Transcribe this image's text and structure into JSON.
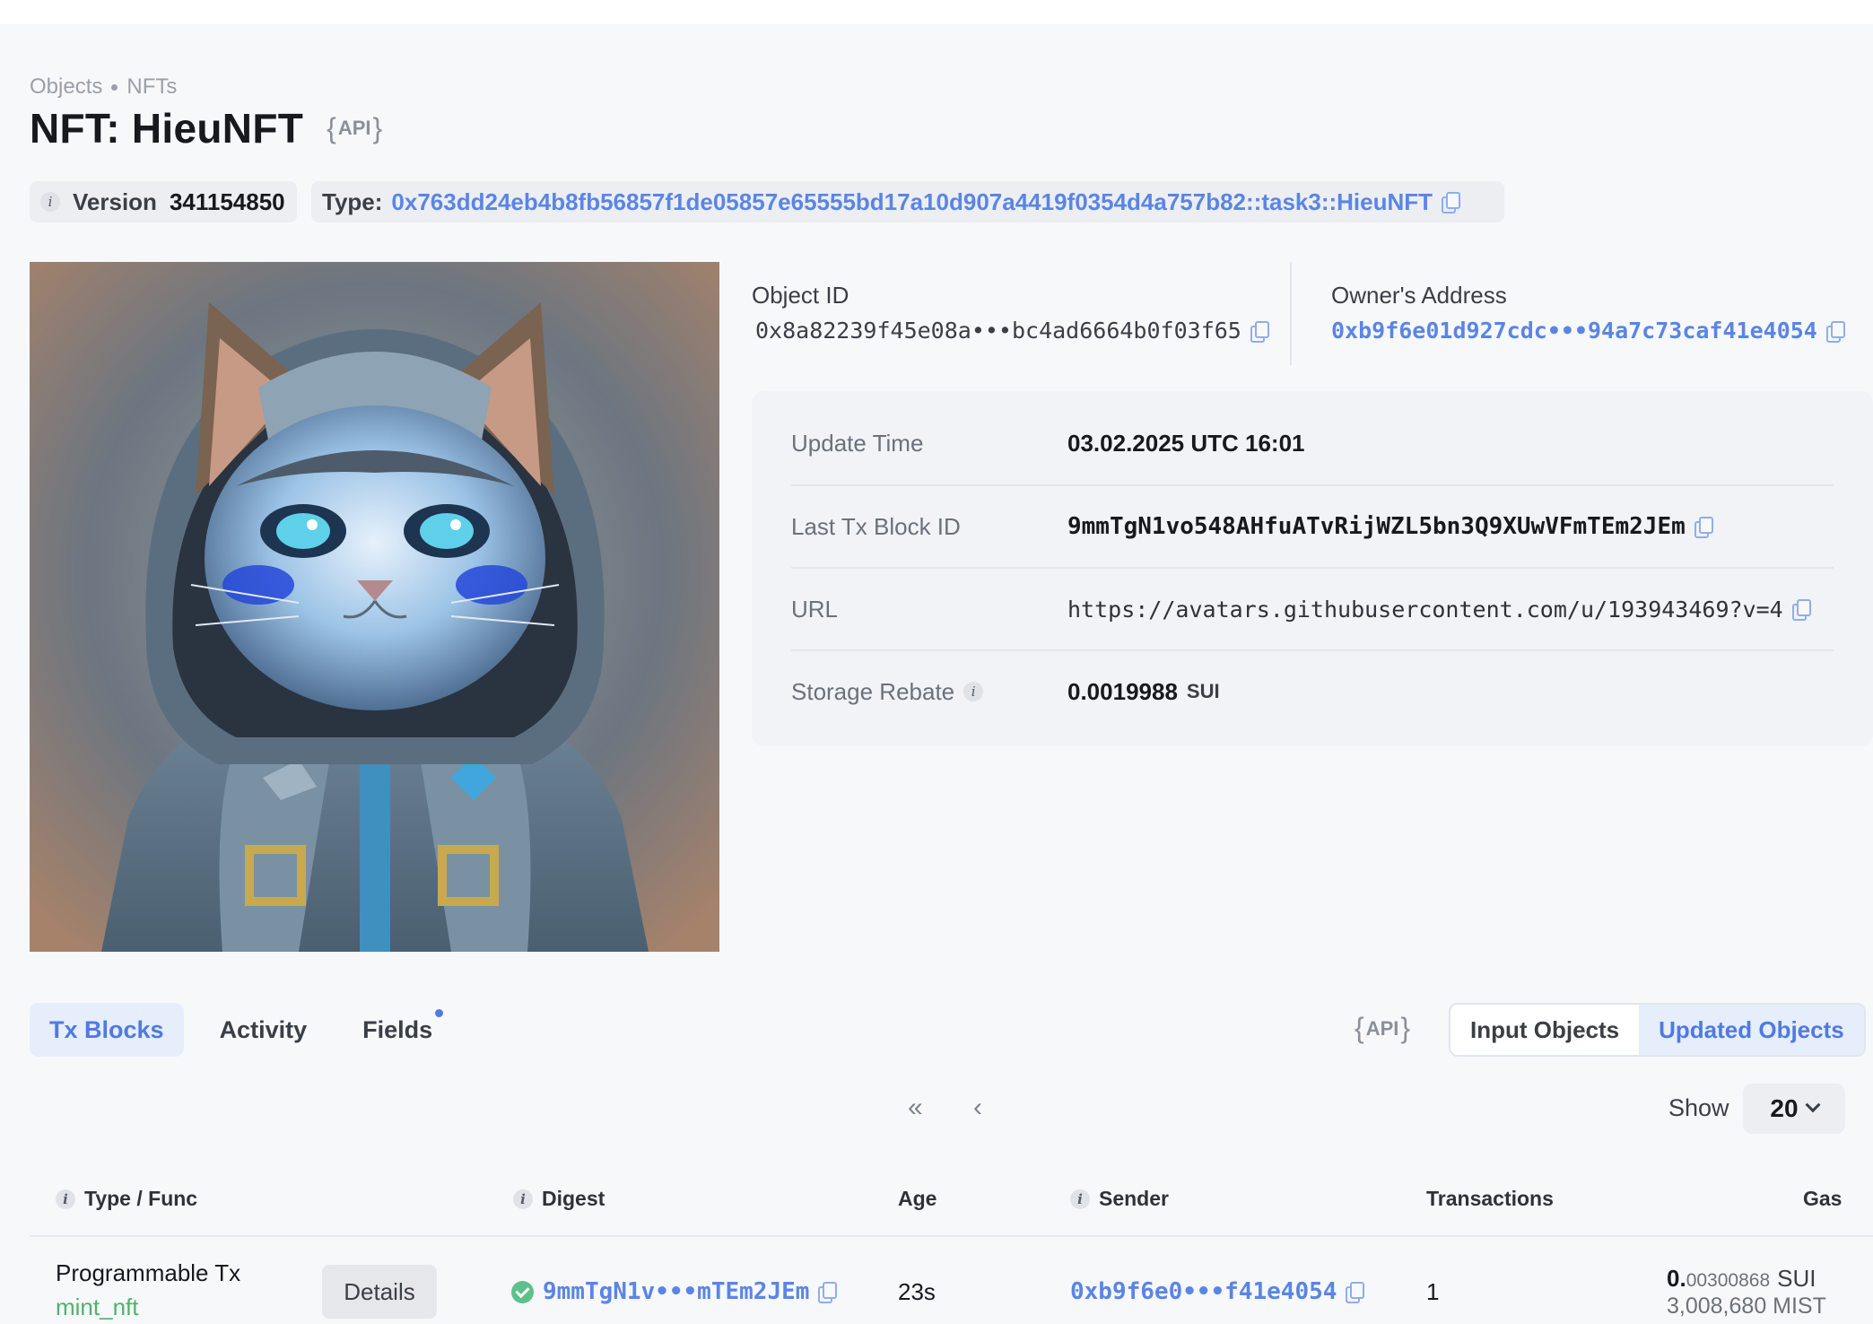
{
  "breadcrumb": [
    "Objects",
    "NFTs"
  ],
  "title": "NFT: HieuNFT",
  "api_badge": "API",
  "version": {
    "label": "Version",
    "value": "341154850"
  },
  "type": {
    "label": "Type:",
    "value": "0x763dd24eb4b8fb56857f1de05857e65555bd17a10d907a4419f0354d4a757b82::task3::HieuNFT"
  },
  "object": {
    "label": "Object ID",
    "value": "0x8a82239f45e08a•••bc4ad6664b0f03f65"
  },
  "owner": {
    "label": "Owner's Address",
    "value": "0xb9f6e01d927cdc•••94a7c73caf41e4054"
  },
  "details": {
    "update_time": {
      "label": "Update Time",
      "value": "03.02.2025 UTC 16:01"
    },
    "last_tx": {
      "label": "Last Tx Block ID",
      "value": "9mmTgN1vo548AHfuATvRijWZL5bn3Q9XUwVFmTEm2JEm"
    },
    "url": {
      "label": "URL",
      "value": "https://avatars.githubusercontent.com/u/193943469?v=4"
    },
    "storage_rebate": {
      "label": "Storage Rebate",
      "value": "0.0019988",
      "unit": "SUI"
    }
  },
  "tabs": [
    "Tx Blocks",
    "Activity",
    "Fields"
  ],
  "segment": [
    "Input Objects",
    "Updated Objects"
  ],
  "pagination": {
    "first": "«",
    "prev": "‹"
  },
  "show": {
    "label": "Show",
    "value": "20"
  },
  "table": {
    "headers": [
      "Type / Func",
      "Digest",
      "Age",
      "Sender",
      "Transactions",
      "Gas"
    ],
    "row": {
      "type": "Programmable Tx",
      "func": "mint_nft",
      "details": "Details",
      "digest": "9mmTgN1v•••mTEm2JEm",
      "age": "23s",
      "sender": "0xb9f6e0•••f41e4054",
      "transactions": "1",
      "gas_int": "0.",
      "gas_frac": "00300868",
      "gas_unit": "SUI",
      "gas_mist": "3,008,680 MIST"
    }
  },
  "colors": {
    "accent": "#5a85e6",
    "success": "#5ec08a",
    "func": "#4db36a"
  },
  "icons": [
    "info-icon",
    "copy-icon",
    "check-circle-icon",
    "chevron-down-icon",
    "chevron-double-left-icon",
    "chevron-left-icon"
  ]
}
